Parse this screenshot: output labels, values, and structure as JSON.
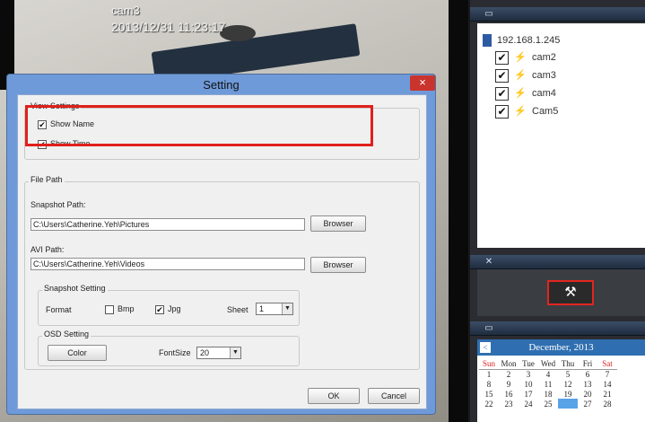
{
  "video": {
    "camera_name": "cam3",
    "timestamp": "2013/12/31  11:23:17"
  },
  "device_tree": {
    "root_ip": "192.168.1.245",
    "cameras": [
      {
        "label": "cam2",
        "checked": "✔"
      },
      {
        "label": "cam3",
        "checked": "✔"
      },
      {
        "label": "cam4",
        "checked": "✔"
      },
      {
        "label": "Cam5",
        "checked": "✔"
      }
    ]
  },
  "tools": {
    "icon": "wrench-icon",
    "glyph": "🔧"
  },
  "calendar": {
    "month": "December, 2013",
    "prev": "<",
    "weekdays": [
      "Sun",
      "Mon",
      "Tue",
      "Wed",
      "Thu",
      "Fri",
      "Sat"
    ],
    "weeks": [
      [
        "1",
        "2",
        "3",
        "4",
        "5",
        "6",
        "7"
      ],
      [
        "8",
        "9",
        "10",
        "11",
        "12",
        "13",
        "14"
      ],
      [
        "15",
        "16",
        "17",
        "18",
        "19",
        "20",
        "21"
      ],
      [
        "22",
        "23",
        "24",
        "25",
        "26",
        "27",
        "28"
      ]
    ]
  },
  "dialog": {
    "title": "Setting",
    "close": "×",
    "view_settings": {
      "label": "View Settings",
      "show_name": "Show Name",
      "show_time": "Show Time",
      "check": "✔"
    },
    "file_path": {
      "label": "File Path",
      "snapshot_label": "Snapshot Path:",
      "snapshot_value": "C:\\Users\\Catherine.Yeh\\Pictures",
      "avi_label": "AVI Path:",
      "avi_value": "C:\\Users\\Catherine.Yeh\\Videos",
      "browser": "Browser"
    },
    "snapshot_setting": {
      "label": "Snapshot Setting",
      "format": "Format",
      "bmp": "Bmp",
      "jpg": "Jpg",
      "jpg_check": "✔",
      "sheet": "Sheet",
      "sheet_value": "1"
    },
    "osd_setting": {
      "label": "OSD Setting",
      "color": "Color",
      "fontsize": "FontSize",
      "fontsize_value": "20"
    },
    "ok": "OK",
    "cancel": "Cancel"
  },
  "colors": {
    "highlight": "#e0201b",
    "dialog_frame": "#6f9ad9",
    "today": "#5aa2e8"
  }
}
